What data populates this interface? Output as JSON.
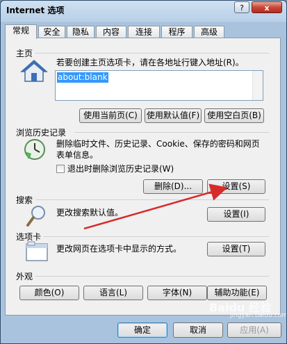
{
  "window": {
    "title": "Internet 选项",
    "help_label": "?",
    "close_label": "x"
  },
  "tabs": [
    "常规",
    "安全",
    "隐私",
    "内容",
    "连接",
    "程序",
    "高级"
  ],
  "home": {
    "section_label": "主页",
    "desc": "若要创建主页选项卡，请在各地址行键入地址(R)。",
    "url_value": "about:blank",
    "btn_current": "使用当前页(C)",
    "btn_default": "使用默认值(F)",
    "btn_blank": "使用空白页(B)"
  },
  "history": {
    "section_label": "浏览历史记录",
    "desc_line1": "删除临时文件、历史记录、Cookie、保存的密码和网页",
    "desc_line2": "表单信息。",
    "checkbox_label": "退出时删除浏览历史记录(W)",
    "btn_delete": "删除(D)...",
    "btn_settings": "设置(S)"
  },
  "search": {
    "section_label": "搜索",
    "desc": "更改搜索默认值。",
    "btn_settings": "设置(I)"
  },
  "tabs_section": {
    "section_label": "选项卡",
    "desc": "更改网页在选项卡中显示的方式。",
    "btn_settings": "设置(T)"
  },
  "appearance": {
    "section_label": "外观",
    "btn_colors": "颜色(O)",
    "btn_languages": "语言(L)",
    "btn_fonts": "字体(N)",
    "btn_accessibility": "辅助功能(E)"
  },
  "footer": {
    "ok": "确定",
    "cancel": "取消",
    "apply": "应用(A)"
  },
  "watermark": {
    "brand": "Baidu 经验",
    "sub": "jingyan.baidu.com"
  },
  "colors": {
    "arrow": "#d62b2b",
    "selection": "#3399ff"
  }
}
